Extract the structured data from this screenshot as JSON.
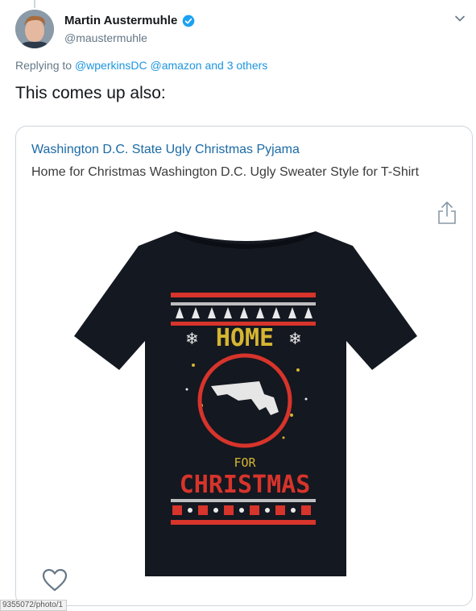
{
  "tweet": {
    "author_name": "Martin Austermuhle",
    "author_handle": "@maustermuhle",
    "replying_prefix": "Replying to",
    "reply_mention_1": "@wperkinsDC",
    "reply_mention_2": "@amazon",
    "reply_and": "and",
    "reply_others": "3 others",
    "text": "This comes up also:"
  },
  "card": {
    "title": "Washington D.C. State Ugly Christmas Pyjama",
    "description": "Home for Christmas Washington D.C. Ugly Sweater Style for T-Shirt",
    "shirt_text_top": "HOME",
    "shirt_text_for": "FOR",
    "shirt_text_bottom": "CHRISTMAS"
  },
  "status_url_fragment": "9355072/photo/1",
  "colors": {
    "link": "#1b95e0",
    "card_title": "#1b6aa5",
    "verified": "#1da1f2",
    "shirt": "#141820",
    "shirt_red": "#d7342b",
    "shirt_yellow": "#d6b531"
  },
  "icons": [
    "verified-badge-icon",
    "chevron-down-icon",
    "share-icon",
    "heart-icon"
  ]
}
